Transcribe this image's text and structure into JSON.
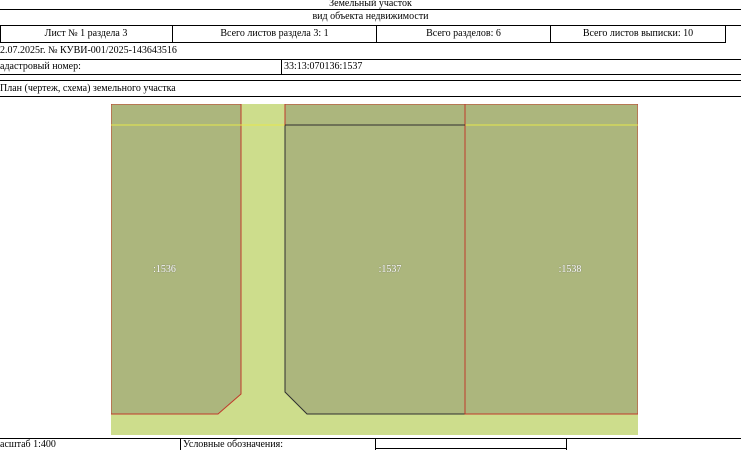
{
  "header": {
    "object_type": "Земельный участок",
    "object_kind_label": "вид объекта недвижимости"
  },
  "sheet_info": {
    "sheet_of_section": "Лист № 1 раздела 3",
    "total_sheets_section": "Всего листов раздела 3: 1",
    "total_sections": "Всего разделов: 6",
    "total_sheets_extract": "Всего листов выписки: 10"
  },
  "document_ref": "2.07.2025г. № КУВИ-001/2025-143643516",
  "cadastral": {
    "label": "адастровый номер:",
    "value": "33:13:070136:1537"
  },
  "plan_title": "План (чертеж, схема) земельного участка",
  "plan": {
    "colors": {
      "parcel_fill": "#acb67d",
      "road_fill": "#cddd8c",
      "neighbor_border": "#c0392b",
      "subject_border": "#2f2f2f",
      "yellow_line": "#e6e84a"
    },
    "parcels": [
      {
        "label": ":1536"
      },
      {
        "label": ":1537"
      },
      {
        "label": ":1538"
      }
    ]
  },
  "footer": {
    "scale": "асштаб 1:400",
    "legend_label": "Условные обозначения:"
  }
}
